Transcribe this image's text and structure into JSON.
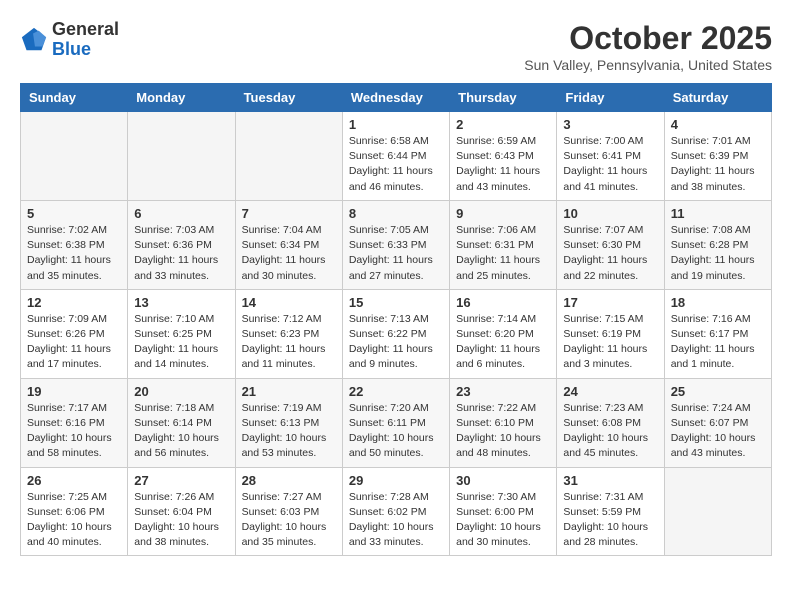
{
  "header": {
    "logo_general": "General",
    "logo_blue": "Blue",
    "month_title": "October 2025",
    "location": "Sun Valley, Pennsylvania, United States"
  },
  "days_of_week": [
    "Sunday",
    "Monday",
    "Tuesday",
    "Wednesday",
    "Thursday",
    "Friday",
    "Saturday"
  ],
  "weeks": [
    [
      {
        "day": "",
        "info": ""
      },
      {
        "day": "",
        "info": ""
      },
      {
        "day": "",
        "info": ""
      },
      {
        "day": "1",
        "info": "Sunrise: 6:58 AM\nSunset: 6:44 PM\nDaylight: 11 hours\nand 46 minutes."
      },
      {
        "day": "2",
        "info": "Sunrise: 6:59 AM\nSunset: 6:43 PM\nDaylight: 11 hours\nand 43 minutes."
      },
      {
        "day": "3",
        "info": "Sunrise: 7:00 AM\nSunset: 6:41 PM\nDaylight: 11 hours\nand 41 minutes."
      },
      {
        "day": "4",
        "info": "Sunrise: 7:01 AM\nSunset: 6:39 PM\nDaylight: 11 hours\nand 38 minutes."
      }
    ],
    [
      {
        "day": "5",
        "info": "Sunrise: 7:02 AM\nSunset: 6:38 PM\nDaylight: 11 hours\nand 35 minutes."
      },
      {
        "day": "6",
        "info": "Sunrise: 7:03 AM\nSunset: 6:36 PM\nDaylight: 11 hours\nand 33 minutes."
      },
      {
        "day": "7",
        "info": "Sunrise: 7:04 AM\nSunset: 6:34 PM\nDaylight: 11 hours\nand 30 minutes."
      },
      {
        "day": "8",
        "info": "Sunrise: 7:05 AM\nSunset: 6:33 PM\nDaylight: 11 hours\nand 27 minutes."
      },
      {
        "day": "9",
        "info": "Sunrise: 7:06 AM\nSunset: 6:31 PM\nDaylight: 11 hours\nand 25 minutes."
      },
      {
        "day": "10",
        "info": "Sunrise: 7:07 AM\nSunset: 6:30 PM\nDaylight: 11 hours\nand 22 minutes."
      },
      {
        "day": "11",
        "info": "Sunrise: 7:08 AM\nSunset: 6:28 PM\nDaylight: 11 hours\nand 19 minutes."
      }
    ],
    [
      {
        "day": "12",
        "info": "Sunrise: 7:09 AM\nSunset: 6:26 PM\nDaylight: 11 hours\nand 17 minutes."
      },
      {
        "day": "13",
        "info": "Sunrise: 7:10 AM\nSunset: 6:25 PM\nDaylight: 11 hours\nand 14 minutes."
      },
      {
        "day": "14",
        "info": "Sunrise: 7:12 AM\nSunset: 6:23 PM\nDaylight: 11 hours\nand 11 minutes."
      },
      {
        "day": "15",
        "info": "Sunrise: 7:13 AM\nSunset: 6:22 PM\nDaylight: 11 hours\nand 9 minutes."
      },
      {
        "day": "16",
        "info": "Sunrise: 7:14 AM\nSunset: 6:20 PM\nDaylight: 11 hours\nand 6 minutes."
      },
      {
        "day": "17",
        "info": "Sunrise: 7:15 AM\nSunset: 6:19 PM\nDaylight: 11 hours\nand 3 minutes."
      },
      {
        "day": "18",
        "info": "Sunrise: 7:16 AM\nSunset: 6:17 PM\nDaylight: 11 hours\nand 1 minute."
      }
    ],
    [
      {
        "day": "19",
        "info": "Sunrise: 7:17 AM\nSunset: 6:16 PM\nDaylight: 10 hours\nand 58 minutes."
      },
      {
        "day": "20",
        "info": "Sunrise: 7:18 AM\nSunset: 6:14 PM\nDaylight: 10 hours\nand 56 minutes."
      },
      {
        "day": "21",
        "info": "Sunrise: 7:19 AM\nSunset: 6:13 PM\nDaylight: 10 hours\nand 53 minutes."
      },
      {
        "day": "22",
        "info": "Sunrise: 7:20 AM\nSunset: 6:11 PM\nDaylight: 10 hours\nand 50 minutes."
      },
      {
        "day": "23",
        "info": "Sunrise: 7:22 AM\nSunset: 6:10 PM\nDaylight: 10 hours\nand 48 minutes."
      },
      {
        "day": "24",
        "info": "Sunrise: 7:23 AM\nSunset: 6:08 PM\nDaylight: 10 hours\nand 45 minutes."
      },
      {
        "day": "25",
        "info": "Sunrise: 7:24 AM\nSunset: 6:07 PM\nDaylight: 10 hours\nand 43 minutes."
      }
    ],
    [
      {
        "day": "26",
        "info": "Sunrise: 7:25 AM\nSunset: 6:06 PM\nDaylight: 10 hours\nand 40 minutes."
      },
      {
        "day": "27",
        "info": "Sunrise: 7:26 AM\nSunset: 6:04 PM\nDaylight: 10 hours\nand 38 minutes."
      },
      {
        "day": "28",
        "info": "Sunrise: 7:27 AM\nSunset: 6:03 PM\nDaylight: 10 hours\nand 35 minutes."
      },
      {
        "day": "29",
        "info": "Sunrise: 7:28 AM\nSunset: 6:02 PM\nDaylight: 10 hours\nand 33 minutes."
      },
      {
        "day": "30",
        "info": "Sunrise: 7:30 AM\nSunset: 6:00 PM\nDaylight: 10 hours\nand 30 minutes."
      },
      {
        "day": "31",
        "info": "Sunrise: 7:31 AM\nSunset: 5:59 PM\nDaylight: 10 hours\nand 28 minutes."
      },
      {
        "day": "",
        "info": ""
      }
    ]
  ]
}
